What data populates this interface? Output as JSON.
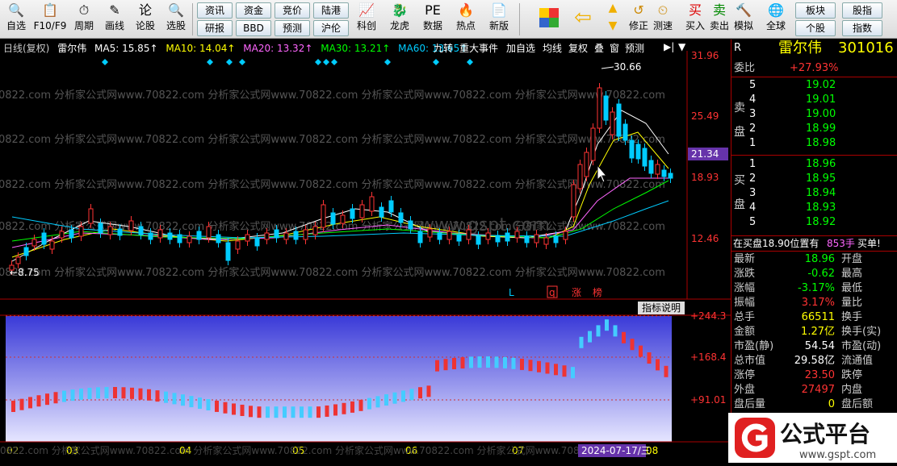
{
  "toolbar": {
    "items": [
      {
        "label": "自选",
        "icon": "🔍"
      },
      {
        "label": "F10/F9",
        "icon": "📋"
      },
      {
        "label": "周期",
        "icon": "⏱"
      },
      {
        "label": "画线",
        "icon": "✎"
      },
      {
        "label": "论股",
        "icon": "论"
      },
      {
        "label": "选股",
        "icon": "🔍"
      }
    ],
    "small_buttons": [
      [
        "资讯",
        "研报"
      ],
      [
        "资金",
        "BBD"
      ],
      [
        "竞价",
        "预测"
      ],
      [
        "陆港",
        "沪伦"
      ]
    ],
    "items2": [
      {
        "label": "科创",
        "icon": "📈"
      },
      {
        "label": "龙虎",
        "icon": "🐉"
      },
      {
        "label": "数据",
        "icon": "PE"
      },
      {
        "label": "热点",
        "icon": "🔥"
      },
      {
        "label": "新版",
        "icon": "📄"
      }
    ],
    "items3": [
      {
        "label": "修正",
        "icon": "↺"
      },
      {
        "label": "测速",
        "icon": "⏲"
      },
      {
        "label": "买入",
        "icon": "买"
      },
      {
        "label": "卖出",
        "icon": "卖"
      },
      {
        "label": "模拟",
        "icon": "🔨"
      },
      {
        "label": "全球",
        "icon": "🌐"
      }
    ],
    "small_buttons2": [
      [
        "板块",
        "个股"
      ],
      [
        "股指",
        "指数"
      ]
    ]
  },
  "chart": {
    "period": "日线(复权)",
    "name": "雷尔伟",
    "ma5": "MA5: 15.85↑",
    "ma10": "MA10: 14.04↑",
    "ma20": "MA20: 13.32↑",
    "ma30": "MA30: 13.21↑",
    "ma60": "MA60: 13.65↑",
    "top_buttons": [
      "九转",
      "重大事件",
      "加自选",
      "均线",
      "复权",
      "叠",
      "窗",
      "预测"
    ],
    "price_axis": [
      "31.96",
      "25.49",
      "21.34",
      "18.93",
      "12.46"
    ],
    "current_price_label": "21.34",
    "high_label": "30.66",
    "low_label": "8.75",
    "markers": [
      "L",
      "q",
      "涨",
      "榜"
    ],
    "indicator_button": "指标说明",
    "ind_axis": [
      "+244.3",
      "+168.4",
      "+91.01"
    ],
    "months": [
      "02",
      "03",
      "04",
      "05",
      "06",
      "07",
      "08"
    ],
    "cursor_date": "2024-07-17/三",
    "watermark": "0822.com 分析家公式网www.70822.com 分析家公式网www.70822.com 分析家公式网www.70822.com 分析家公式网www.70822.com",
    "watermark2": "www.gspt.com"
  },
  "chart_data": {
    "type": "candlestick",
    "title": "雷尔伟 301016 日线",
    "ylim": [
      8.5,
      31.96
    ],
    "high": 30.66,
    "low": 8.75,
    "series": [
      {
        "name": "MA5",
        "value": 15.85
      },
      {
        "name": "MA10",
        "value": 14.04
      },
      {
        "name": "MA20",
        "value": 13.32
      },
      {
        "name": "MA30",
        "value": 13.21
      },
      {
        "name": "MA60",
        "value": 13.65
      }
    ]
  },
  "right": {
    "code_label": "R",
    "name": "雷尔伟",
    "code": "301016",
    "weibi_label": "委比",
    "weibi": "+27.93%",
    "sell_label": "卖盘",
    "buy_label": "买盘",
    "asks": [
      [
        "5",
        "19.02"
      ],
      [
        "4",
        "19.01"
      ],
      [
        "3",
        "19.00"
      ],
      [
        "2",
        "18.99"
      ],
      [
        "1",
        "18.98"
      ]
    ],
    "bids": [
      [
        "1",
        "18.96"
      ],
      [
        "2",
        "18.95"
      ],
      [
        "3",
        "18.94"
      ],
      [
        "4",
        "18.93"
      ],
      [
        "5",
        "18.92"
      ]
    ],
    "notice": "在买盘18.90位置有",
    "notice_vol": "853手",
    "notice_tail": "买单!",
    "stats": [
      [
        "最新",
        "18.96",
        "开盘"
      ],
      [
        "涨跌",
        "-0.62",
        "最高"
      ],
      [
        "涨幅",
        "-3.17%",
        "最低"
      ],
      [
        "振幅",
        "3.17%",
        "量比"
      ],
      [
        "总手",
        "66511",
        "换手"
      ],
      [
        "金额",
        "1.27亿",
        "换手(实)"
      ],
      [
        "市盈(静)",
        "54.54",
        "市盈(动)"
      ],
      [
        "总市值",
        "29.58亿",
        "流通值"
      ],
      [
        "涨停",
        "23.50",
        "跌停"
      ],
      [
        "外盘",
        "27497",
        "内盘"
      ],
      [
        "盘后量",
        "0",
        "盘后额"
      ]
    ],
    "logo_text": "公式平台",
    "logo_url": "www.gspt.com"
  }
}
